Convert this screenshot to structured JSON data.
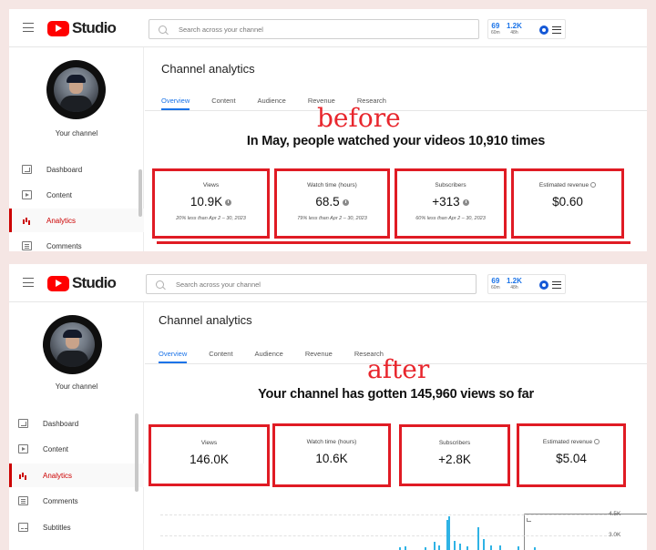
{
  "colors": {
    "accent": "#1a73e8",
    "highlight_red": "#e01b24",
    "brand_red": "#ff0000",
    "chart_bar": "#2fb3e5"
  },
  "app": {
    "logo_text": "Studio",
    "search_placeholder": "Search across your channel",
    "header_stats": [
      {
        "value": "69",
        "label": "60m"
      },
      {
        "value": "1.2K",
        "label": "48h"
      }
    ],
    "icons": [
      "menu-icon",
      "youtube-logo-icon",
      "search-icon",
      "analytics-icon",
      "channel-badge-icon",
      "more-menu-icon"
    ]
  },
  "panels": {
    "before": {
      "overlay_label": "before",
      "your_channel": "Your channel",
      "nav": [
        "Dashboard",
        "Content",
        "Analytics",
        "Comments"
      ],
      "active_nav": "Analytics",
      "page_title": "Channel analytics",
      "tabs": [
        "Overview",
        "Content",
        "Audience",
        "Revenue",
        "Research"
      ],
      "active_tab": "Overview",
      "headline": "In May, people watched your videos 10,910 times",
      "cards": [
        {
          "title": "Views",
          "value": "10.9K",
          "icon": "down-arrow-icon",
          "note": "20% less than Apr 2 – 30, 2023"
        },
        {
          "title": "Watch time (hours)",
          "value": "68.5",
          "icon": "down-arrow-icon",
          "note": "79% less than Apr 2 – 30, 2023"
        },
        {
          "title": "Subscribers",
          "value": "+313",
          "icon": "down-arrow-icon",
          "note": "60% less than Apr 2 – 30, 2023"
        },
        {
          "title": "Estimated revenue",
          "value": "$0.60",
          "icon": "clock-icon",
          "note": ""
        }
      ]
    },
    "after": {
      "overlay_label": "after",
      "your_channel": "Your channel",
      "nav": [
        "Dashboard",
        "Content",
        "Analytics",
        "Comments",
        "Subtitles"
      ],
      "active_nav": "Analytics",
      "page_title": "Channel analytics",
      "tabs": [
        "Overview",
        "Content",
        "Audience",
        "Revenue",
        "Research"
      ],
      "active_tab": "Overview",
      "headline": "Your channel has gotten 145,960 views so far",
      "cards": [
        {
          "title": "Views",
          "value": "146.0K",
          "icon": "",
          "note": ""
        },
        {
          "title": "Watch time (hours)",
          "value": "10.6K",
          "icon": "",
          "note": ""
        },
        {
          "title": "Subscribers",
          "value": "+2.8K",
          "icon": "",
          "note": ""
        },
        {
          "title": "Estimated revenue",
          "value": "$5.04",
          "icon": "clock-icon",
          "note": ""
        }
      ],
      "chart_axis": [
        "4.5K",
        "3.0K"
      ]
    }
  },
  "chart_data": {
    "type": "bar",
    "ylim": [
      0,
      4500
    ],
    "yticks": [
      "4.5K",
      "3.0K"
    ],
    "values": [
      120,
      200,
      150,
      800,
      300,
      3600,
      4000,
      900,
      600,
      250,
      2600,
      1100,
      400,
      300,
      200,
      150
    ],
    "grid": true
  }
}
